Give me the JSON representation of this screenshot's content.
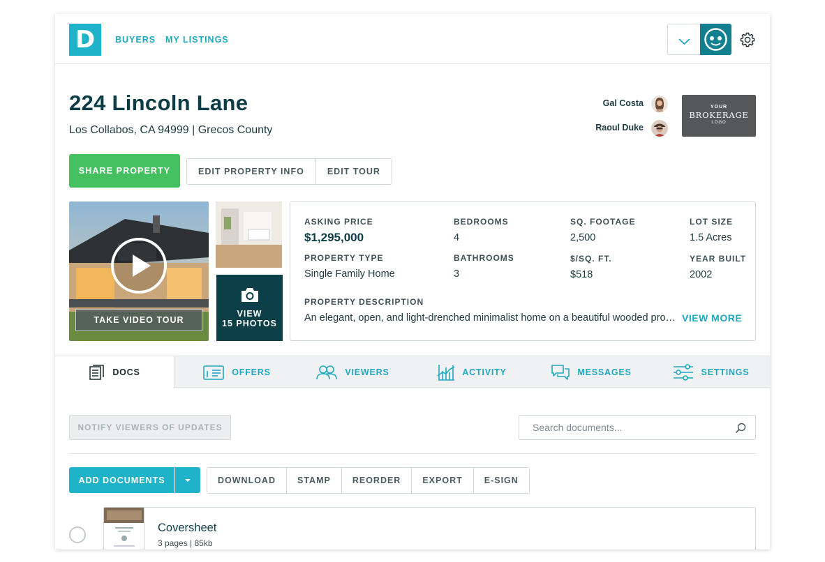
{
  "nav": {
    "logo_letter": "D",
    "links": [
      "BUYERS",
      "MY LISTINGS"
    ]
  },
  "property": {
    "title": "224 Lincoln Lane",
    "subtitle": "Los Collabos, CA 94999 | Grecos County"
  },
  "agents": [
    {
      "name": "Gal Costa"
    },
    {
      "name": "Raoul Duke"
    }
  ],
  "brokerage": {
    "line1": "YOUR",
    "line2": "BROKERAGE",
    "line3": "LOGO"
  },
  "actions": {
    "share": "SHARE PROPERTY",
    "edit_info": "EDIT PROPERTY INFO",
    "edit_tour": "EDIT TOUR"
  },
  "media": {
    "tour_label": "TAKE VIDEO TOUR",
    "photos_line1": "VIEW",
    "photos_line2": "15 PHOTOS"
  },
  "details": {
    "asking_price_label": "ASKING PRICE",
    "asking_price": "$1,295,000",
    "bedrooms_label": "BEDROOMS",
    "bedrooms": "4",
    "sqft_label": "SQ. FOOTAGE",
    "sqft": "2,500",
    "lot_label": "LOT SIZE",
    "lot": "1.5 Acres",
    "type_label": "PROPERTY TYPE",
    "type": "Single Family Home",
    "bathrooms_label": "BATHROOMS",
    "bathrooms": "3",
    "ppsf_label": "$/SQ. FT.",
    "ppsf": "$518",
    "year_label": "YEAR BUILT",
    "year": "2002",
    "desc_label": "PROPERTY DESCRIPTION",
    "desc": "An elegant, open, and light-drenched minimalist home on a beautiful wooded property",
    "view_more": "VIEW MORE"
  },
  "tabs": [
    "DOCS",
    "OFFERS",
    "VIEWERS",
    "ACTIVITY",
    "MESSAGES",
    "SETTINGS"
  ],
  "docs": {
    "notify": "NOTIFY VIEWERS OF UPDATES",
    "search_placeholder": "Search documents...",
    "add": "ADD DOCUMENTS",
    "toolbar": [
      "DOWNLOAD",
      "STAMP",
      "REORDER",
      "EXPORT",
      "E-SIGN"
    ],
    "items": [
      {
        "title": "Coversheet",
        "meta": "3 pages  |  85kb"
      }
    ]
  },
  "colors": {
    "accent": "#1fb3c9",
    "green": "#45c061",
    "dark_teal": "#0c3f47"
  },
  "icons": [
    "chevron-down-icon",
    "face-icon",
    "gear-icon",
    "play-icon",
    "camera-icon",
    "docs-icon",
    "offers-icon",
    "viewers-icon",
    "activity-icon",
    "messages-icon",
    "settings-sliders-icon",
    "search-icon",
    "caret-down-icon"
  ]
}
